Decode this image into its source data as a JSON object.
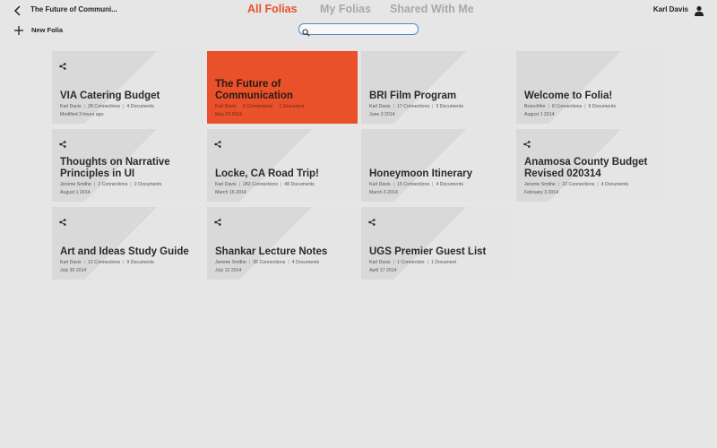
{
  "header": {
    "doc_title": "The Future of Communi...",
    "tabs": [
      {
        "label": "All Folias",
        "active": true
      },
      {
        "label": "My Folias",
        "active": false
      },
      {
        "label": "Shared With Me",
        "active": false
      }
    ],
    "user_name": "Karl Davis"
  },
  "toolbar": {
    "new_folia_label": "New Folia"
  },
  "search": {
    "value": "",
    "placeholder": ""
  },
  "colors": {
    "accent": "#e8512a",
    "card_bg": "#d9d9d9",
    "search_border": "#4f8fcf"
  },
  "cards": [
    {
      "title": "VIA Catering Budget",
      "owner": "Karl Davis",
      "connections": "28 Connections",
      "documents": "4 Documents",
      "date": "Modified 3 hours ago",
      "shared": true,
      "highlight": false
    },
    {
      "title": "The Future of Communication",
      "owner": "Karl Davis",
      "connections": "6 Connections",
      "documents": "1 Document",
      "date": "May 23 2014",
      "shared": false,
      "highlight": true
    },
    {
      "title": "BRI Film Program",
      "owner": "Karl Davis",
      "connections": "17 Connections",
      "documents": "3 Documents",
      "date": "June 3 2014",
      "shared": false,
      "highlight": false
    },
    {
      "title": "Welcome to Folia!",
      "owner": "Branchfire",
      "connections": "8 Connections",
      "documents": "6 Documents",
      "date": "August 1 2014",
      "shared": false,
      "highlight": false
    },
    {
      "title": "Thoughts on Narrative Principles in UI",
      "owner": "Jerome Smithe",
      "connections": "2 Connections",
      "documents": "2 Documents",
      "date": "August 1 2014",
      "shared": true,
      "highlight": false
    },
    {
      "title": "Locke, CA Road Trip!",
      "owner": "Karl Davis",
      "connections": "282 Connections",
      "documents": "48 Documents",
      "date": "March 16 2014",
      "shared": true,
      "highlight": false
    },
    {
      "title": "Honeymoon Itinerary",
      "owner": "Karl Davis",
      "connections": "15 Connections",
      "documents": "4 Documents",
      "date": "March 3 2014",
      "shared": false,
      "highlight": false
    },
    {
      "title": "Anamosa County Budget Revised 020314",
      "owner": "Jerome Smithe",
      "connections": "22 Connections",
      "documents": "4 Documents",
      "date": "February 3 2014",
      "shared": true,
      "highlight": false
    },
    {
      "title": "Art and Ideas Study Guide",
      "owner": "Karl Davis",
      "connections": "12 Connections",
      "documents": "9 Documents",
      "date": "July 30 2014",
      "shared": true,
      "highlight": false
    },
    {
      "title": "Shankar Lecture Notes",
      "owner": "Jerome Smithe",
      "connections": "36 Connections",
      "documents": "4 Documents",
      "date": "July 12 2014",
      "shared": true,
      "highlight": false
    },
    {
      "title": "UGS Premier Guest List",
      "owner": "Karl Davis",
      "connections": "1 Connection",
      "documents": "1 Document",
      "date": "April 17 2014",
      "shared": true,
      "highlight": false
    }
  ]
}
